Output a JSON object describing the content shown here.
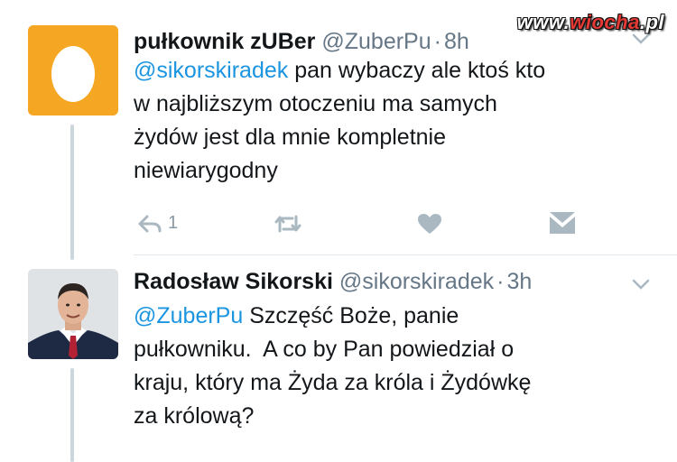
{
  "watermark": {
    "prefix": "www.",
    "brand": "wiocha",
    "suffix": ".pl"
  },
  "tweets": [
    {
      "name": "pułkownik zUBer",
      "handle": "@ZuberPu",
      "sep": "·",
      "time": "8h",
      "mention": "@sikorskiradek",
      "lines": [
        " pan wybaczy ale ktoś kto",
        "w najbliższym otoczeniu ma samych",
        "żydów jest dla mnie kompletnie",
        "niewiarygodny"
      ],
      "reply_count": "1",
      "avatar_icon": "egg-icon"
    },
    {
      "name": "Radosław Sikorski",
      "handle": "@sikorskiradek",
      "sep": "·",
      "time": "3h",
      "mention": "@ZuberPu",
      "lines": [
        " Szczęść Boże, panie",
        "pułkowniku.  A co by Pan powiedział o",
        "kraju, który ma Żyda za króla i Żydówkę",
        "za królową?"
      ],
      "avatar_icon": "profile-photo"
    }
  ],
  "colors": {
    "link": "#1b95e0",
    "meta": "#657786",
    "icon": "#aab8c2",
    "egg_bg": "#f5a623"
  }
}
